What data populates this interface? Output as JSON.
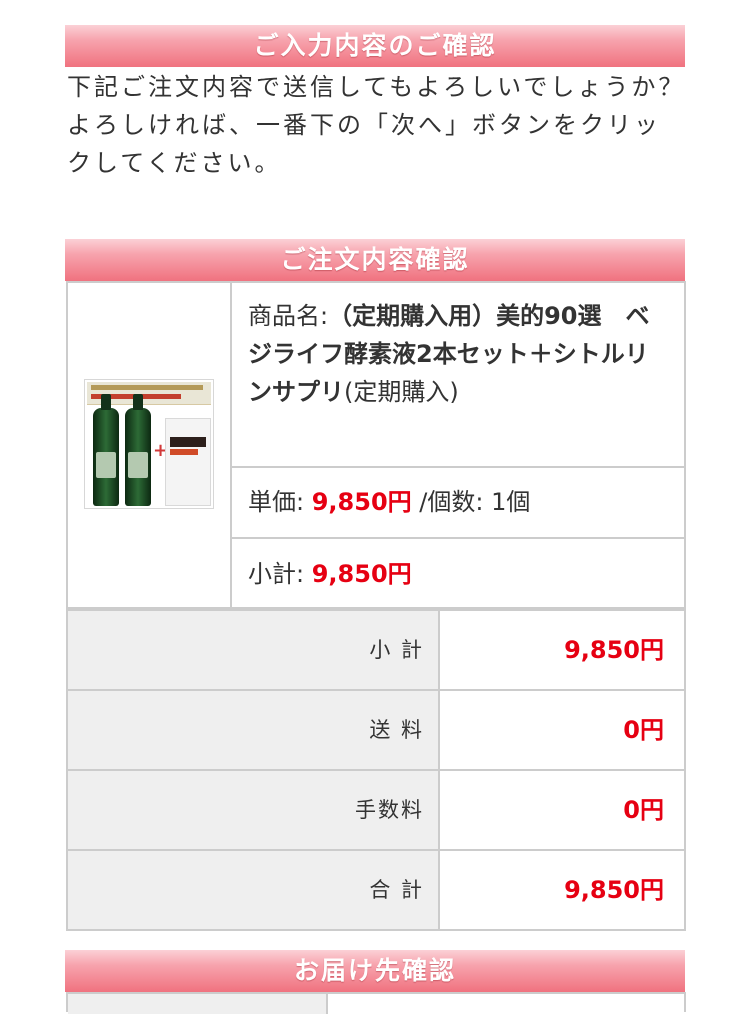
{
  "confirm_section": {
    "title": "ご入力内容のご確認",
    "intro_line1": "下記ご注文内容で送信してもよろしいでしょうか？",
    "intro_line2": "よろしければ、一番下の「次へ」ボタンをクリックしてください。"
  },
  "order_section": {
    "title": "ご注文内容確認",
    "product": {
      "name_label": "商品名:",
      "name": "（定期購入用）美的90選　ベジライフ酵素液2本セット＋シトルリンサプリ",
      "name_suffix": "(定期購入)",
      "unit_price_label": "単価:",
      "unit_price": "9,850円",
      "quantity_label": "/個数:",
      "quantity": "1個",
      "line_subtotal_label": "小計:",
      "line_subtotal": "9,850円"
    },
    "totals": [
      {
        "label": "小 計",
        "value": "9,850円"
      },
      {
        "label": "送 料",
        "value": "0円"
      },
      {
        "label": "手数料",
        "value": "0円"
      },
      {
        "label": "合 計",
        "value": "9,850円"
      }
    ]
  },
  "delivery_section": {
    "title": "お届け先確認"
  },
  "colors": {
    "header_gradient_top": "#fbd0d6",
    "header_gradient_bottom": "#f0727f",
    "price_red": "#e60012",
    "border_gray": "#cccccc",
    "label_bg": "#efefef"
  }
}
